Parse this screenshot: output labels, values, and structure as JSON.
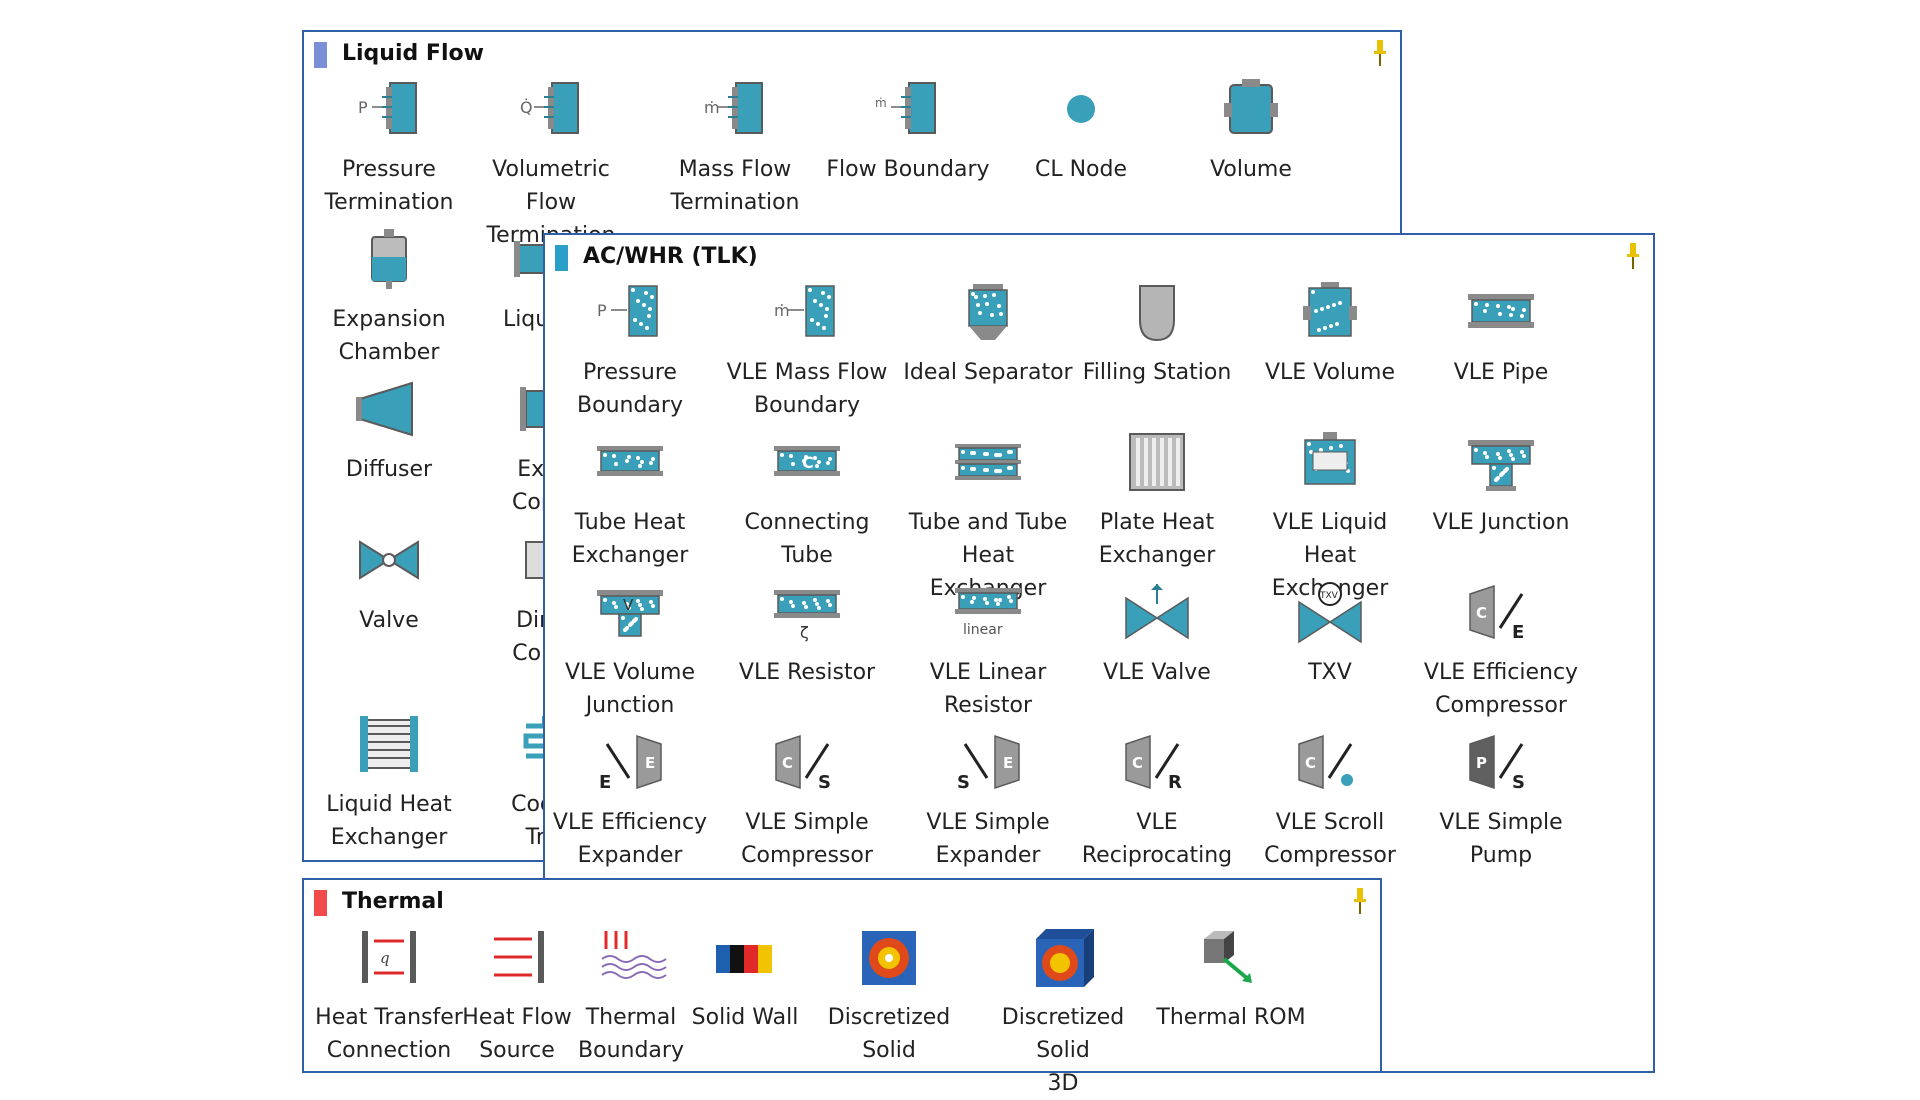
{
  "colors": {
    "border": "#2f5fa8",
    "teal": "#3a9fb8",
    "liquid_flow_marker": "#7b8fd8",
    "acwhr_marker": "#2a9fc7",
    "thermal_marker": "#f24a4a",
    "pin": "#e8c200"
  },
  "liquid_flow": {
    "title": "Liquid Flow",
    "items": [
      {
        "label": "Pressure\nTermination",
        "icon": "pressure-termination-icon"
      },
      {
        "label": "Volumetric Flow\nTermination",
        "icon": "volumetric-flow-termination-icon"
      },
      {
        "label": "Mass Flow\nTermination",
        "icon": "mass-flow-termination-icon"
      },
      {
        "label": "Flow Boundary",
        "icon": "flow-boundary-icon"
      },
      {
        "label": "CL Node",
        "icon": "cl-node-icon"
      },
      {
        "label": "Volume",
        "icon": "volume-icon"
      },
      {
        "label": "Expansion\nChamber",
        "icon": "expansion-chamber-icon"
      },
      {
        "label": "Liquid Fl",
        "icon": "liquid-flow-pipe-icon"
      },
      {
        "label": "Diffuser",
        "icon": "diffuser-icon"
      },
      {
        "label": "Expar\nContra",
        "icon": "expansion-contraction-icon"
      },
      {
        "label": "Valve",
        "icon": "valve-icon"
      },
      {
        "label": "Direct\nContro",
        "icon": "directional-control-icon"
      },
      {
        "label": "Liquid Heat\nExchanger",
        "icon": "liquid-heat-exchanger-icon"
      },
      {
        "label": "Coolan\nTran",
        "icon": "coolant-transport-icon"
      }
    ]
  },
  "acwhr": {
    "title": "AC/WHR (TLK)",
    "items": [
      {
        "label": "Pressure\nBoundary",
        "icon": "pressure-boundary-icon"
      },
      {
        "label": "VLE Mass Flow\nBoundary",
        "icon": "vle-mass-flow-boundary-icon"
      },
      {
        "label": "Ideal Separator",
        "icon": "ideal-separator-icon"
      },
      {
        "label": "Filling Station",
        "icon": "filling-station-icon"
      },
      {
        "label": "VLE Volume",
        "icon": "vle-volume-icon"
      },
      {
        "label": "VLE Pipe",
        "icon": "vle-pipe-icon"
      },
      {
        "label": "Tube Heat\nExchanger",
        "icon": "tube-heat-exchanger-icon"
      },
      {
        "label": "Connecting Tube",
        "icon": "connecting-tube-icon"
      },
      {
        "label": "Tube and Tube\nHeat Exchanger",
        "icon": "tube-and-tube-heat-exchanger-icon"
      },
      {
        "label": "Plate Heat\nExchanger",
        "icon": "plate-heat-exchanger-icon"
      },
      {
        "label": "VLE Liquid Heat\nExchanger",
        "icon": "vle-liquid-heat-exchanger-icon"
      },
      {
        "label": "VLE Junction",
        "icon": "vle-junction-icon"
      },
      {
        "label": "VLE Volume\nJunction",
        "icon": "vle-volume-junction-icon"
      },
      {
        "label": "VLE Resistor",
        "icon": "vle-resistor-icon"
      },
      {
        "label": "VLE Linear\nResistor",
        "icon": "vle-linear-resistor-icon"
      },
      {
        "label": "VLE Valve",
        "icon": "vle-valve-icon"
      },
      {
        "label": "TXV",
        "icon": "txv-icon"
      },
      {
        "label": "VLE Efficiency\nCompressor",
        "icon": "vle-efficiency-compressor-icon"
      },
      {
        "label": "VLE Efficiency\nExpander",
        "icon": "vle-efficiency-expander-icon"
      },
      {
        "label": "VLE Simple\nCompressor",
        "icon": "vle-simple-compressor-icon"
      },
      {
        "label": "VLE Simple\nExpander",
        "icon": "vle-simple-expander-icon"
      },
      {
        "label": "VLE\nReciprocating",
        "icon": "vle-reciprocating-icon"
      },
      {
        "label": "VLE Scroll\nCompressor",
        "icon": "vle-scroll-compressor-icon"
      },
      {
        "label": "VLE Simple\nPump",
        "icon": "vle-simple-pump-icon"
      }
    ]
  },
  "thermal": {
    "title": "Thermal",
    "items": [
      {
        "label": "Heat Transfer\nConnection",
        "icon": "heat-transfer-connection-icon"
      },
      {
        "label": "Heat Flow\nSource",
        "icon": "heat-flow-source-icon"
      },
      {
        "label": "Thermal\nBoundary",
        "icon": "thermal-boundary-icon"
      },
      {
        "label": "Solid Wall",
        "icon": "solid-wall-icon"
      },
      {
        "label": "Discretized Solid",
        "icon": "discretized-solid-icon"
      },
      {
        "label": "Discretized Solid\n3D",
        "icon": "discretized-solid-3d-icon"
      },
      {
        "label": "Thermal ROM",
        "icon": "thermal-rom-icon"
      }
    ]
  },
  "icon_letters": {
    "p": "P",
    "q": "Q̇",
    "m": "ṁ",
    "c": "C",
    "e": "E",
    "s": "S",
    "r": "R",
    "v": "V",
    "linear": "linear",
    "zeta": "ζ",
    "txv": "TXV"
  }
}
